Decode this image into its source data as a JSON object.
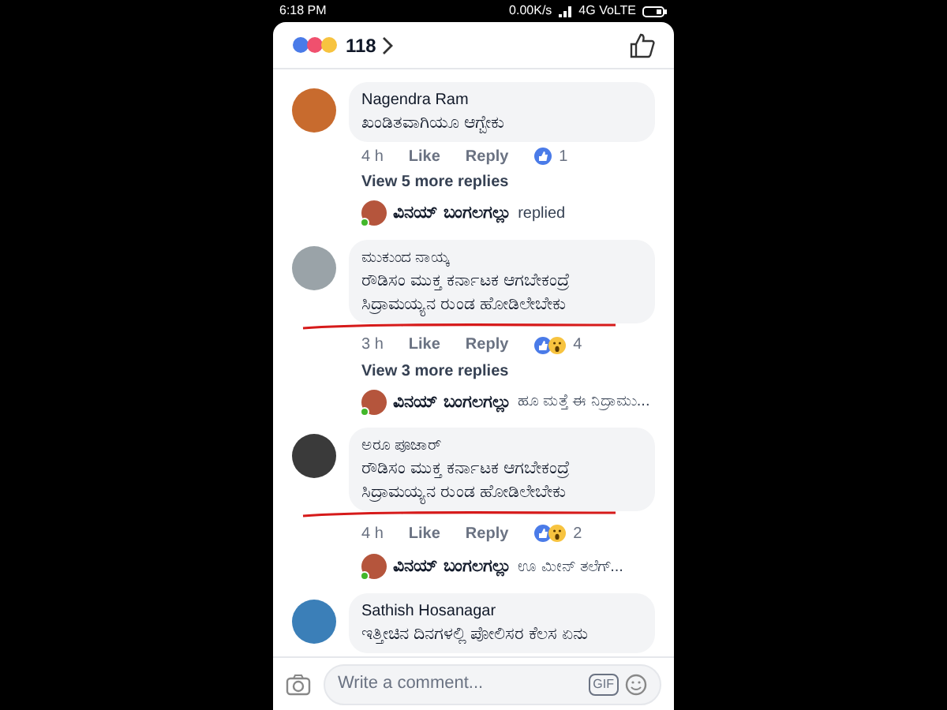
{
  "status_bar": {
    "time": "6:18 PM",
    "speed": "0.00K/s",
    "network": "4G VoLTE"
  },
  "header": {
    "reaction_count": "118"
  },
  "comments": [
    {
      "author": "Nagendra Ram",
      "text": "ಖಂಡಿತವಾಗಿಯೂ ಆಗ್ಬೇಕು",
      "time": "4 h",
      "like": "Like",
      "reply": "Reply",
      "reactions": [
        {
          "kind": "like"
        }
      ],
      "reaction_count": "1",
      "underlined": false,
      "view_more": "View 5 more replies",
      "reply_preview": {
        "author": "ವಿನಯ್ ಬಂಗಲಗಲ್ಲು",
        "text": "replied",
        "online": true
      }
    },
    {
      "author": "ಮುಕುಂದ ನಾಯ್ಕ",
      "text": "ರೌಡಿಸಂ ಮುಕ್ತ ಕರ್ನಾಟಕ ಆಗಬೇಕಂದ್ರೆ ಸಿದ್ರಾಮಯ್ಯನ ರುಂಡ ಹೋಡಿಲೇಬೇಕು",
      "time": "3 h",
      "like": "Like",
      "reply": "Reply",
      "reactions": [
        {
          "kind": "like"
        },
        {
          "kind": "wow"
        }
      ],
      "reaction_count": "4",
      "underlined": true,
      "view_more": "View 3 more replies",
      "reply_preview": {
        "author": "ವಿನಯ್ ಬಂಗಲಗಲ್ಲು",
        "text": "ಹೂ ಮತ್ತೆ ಈ ನಿದ್ರಾಮು...",
        "online": true
      }
    },
    {
      "author": "ಅರೂ ಪೂಜಾರ್",
      "text": "ರೌಡಿಸಂ ಮುಕ್ತ ಕರ್ನಾಟಕ ಆಗಬೇಕಂದ್ರೆ ಸಿದ್ರಾಮಯ್ಯನ ರುಂಡ ಹೋಡಿಲೇಬೇಕು",
      "time": "4 h",
      "like": "Like",
      "reply": "Reply",
      "reactions": [
        {
          "kind": "like"
        },
        {
          "kind": "wow"
        }
      ],
      "reaction_count": "2",
      "underlined": true,
      "reply_preview": {
        "author": "ವಿನಯ್ ಬಂಗಲಗಲ್ಲು",
        "text": "ಊ ಮೀನ್ ತಲೆಗ್...",
        "online": true
      }
    },
    {
      "author": "Sathish Hosanagar",
      "text": "ಇತ್ತೀಚಿನ ದಿನಗಳಲ್ಲಿ ಪೋಲಿಸರ ಕೆಲಸ ಏನು"
    }
  ],
  "composer": {
    "placeholder": "Write a comment...",
    "gif": "GIF"
  }
}
